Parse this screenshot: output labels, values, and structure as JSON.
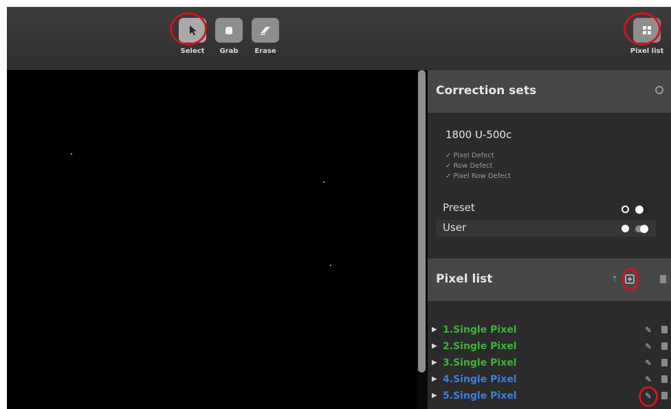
{
  "toolbar": {
    "tools": [
      {
        "label": "Select",
        "icon": "cursor-icon",
        "active": true
      },
      {
        "label": "Grab",
        "icon": "hand-icon",
        "active": false
      },
      {
        "label": "Erase",
        "icon": "eraser-icon",
        "active": false
      }
    ],
    "pixel_list_button": {
      "label": "Pixel list",
      "icon": "grid-icon"
    }
  },
  "correction_sets": {
    "title": "Correction sets",
    "header_icon": "refresh-icon",
    "set_name": "1800 U-500c",
    "defects": [
      "✓ Pixel Defect",
      "✓ Row Defect",
      "✓ Pixel Row Defect"
    ],
    "options": [
      {
        "label": "Preset",
        "selected": false,
        "toggle_on": false
      },
      {
        "label": "User",
        "selected": true,
        "toggle_on": true
      }
    ]
  },
  "pixel_list": {
    "title": "Pixel list",
    "header_icons": [
      "upload-icon",
      "add-icon",
      "trash-icon"
    ],
    "items": [
      {
        "label": "1.Single Pixel",
        "color": "green"
      },
      {
        "label": "2.Single Pixel",
        "color": "green"
      },
      {
        "label": "3.Single Pixel",
        "color": "green"
      },
      {
        "label": "4.Single Pixel",
        "color": "blue"
      },
      {
        "label": "5.Single Pixel",
        "color": "blue"
      }
    ]
  },
  "colors": {
    "highlight_ring": "#d0151e",
    "green_item": "#3fb33a",
    "blue_item": "#3a7fe0"
  }
}
